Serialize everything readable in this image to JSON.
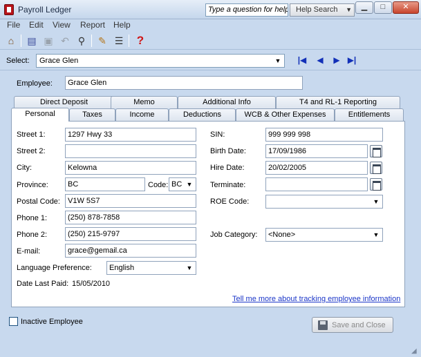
{
  "window": {
    "title": "Payroll Ledger",
    "help_placeholder": "Type a question for help",
    "help_search_label": "Help Search",
    "minimize": "▁",
    "maximize": "□",
    "close": "✕"
  },
  "menu": [
    "File",
    "Edit",
    "View",
    "Report",
    "Help"
  ],
  "toolbar_icons": [
    "home-icon",
    "open-record-icon",
    "save-icon",
    "undo-icon",
    "find-icon",
    "edit-pencil-icon",
    "list-icon",
    "help-question-icon"
  ],
  "select": {
    "label": "Select:",
    "value": "Grace Glen"
  },
  "employee": {
    "label": "Employee:",
    "value": "Grace Glen"
  },
  "tabs_back": [
    "Direct Deposit",
    "Memo",
    "Additional Info",
    "T4 and RL-1 Reporting"
  ],
  "tabs_front": [
    "Personal",
    "Taxes",
    "Income",
    "Deductions",
    "WCB & Other Expenses",
    "Entitlements"
  ],
  "personal": {
    "street1_label": "Street 1:",
    "street1": "1297 Hwy 33",
    "street2_label": "Street 2:",
    "street2": "",
    "city_label": "City:",
    "city": "Kelowna",
    "province_label": "Province:",
    "province": "BC",
    "code_label": "Code:",
    "code": "BC",
    "postal_label": "Postal Code:",
    "postal": "V1W 5S7",
    "phone1_label": "Phone 1:",
    "phone1": "(250) 878-7858",
    "phone2_label": "Phone 2:",
    "phone2": "(250) 215-9797",
    "email_label": "E-mail:",
    "email": "grace@gemail.ca",
    "language_label": "Language Preference:",
    "language": "English",
    "last_paid_label": "Date Last Paid:",
    "last_paid": "15/05/2010",
    "sin_label": "SIN:",
    "sin": "999 999 998",
    "birth_label": "Birth Date:",
    "birth": "17/09/1986",
    "hire_label": "Hire Date:",
    "hire": "20/02/2005",
    "terminate_label": "Terminate:",
    "terminate": "",
    "roe_label": "ROE Code:",
    "roe": "",
    "job_label": "Job Category:",
    "job": "<None>"
  },
  "help_link": "Tell me more about tracking employee information",
  "inactive_label": "Inactive Employee",
  "save_close_label": "Save and Close"
}
